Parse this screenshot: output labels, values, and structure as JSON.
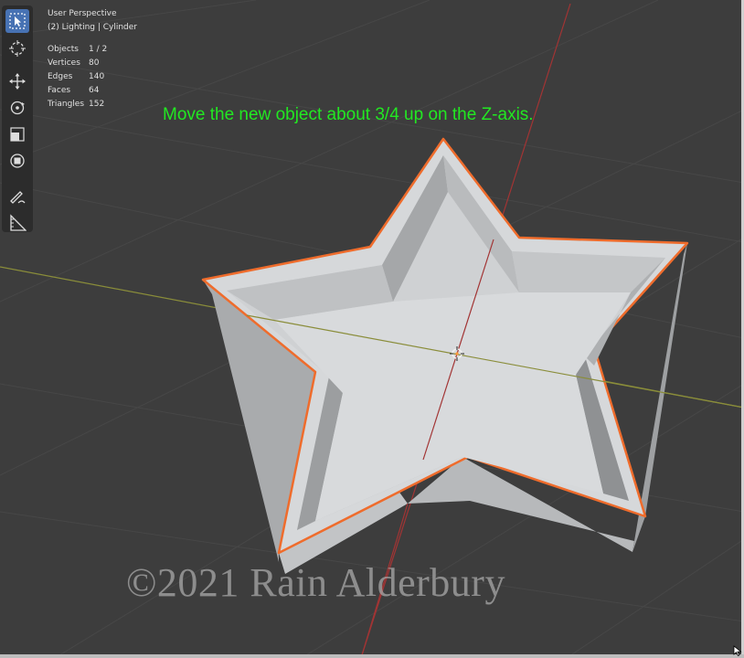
{
  "viewport": {
    "perspective": "User Perspective",
    "collection_info": "(2) Lighting | Cylinder"
  },
  "stats": [
    {
      "label": "Objects",
      "value": "1 / 2"
    },
    {
      "label": "Vertices",
      "value": "80"
    },
    {
      "label": "Edges",
      "value": "140"
    },
    {
      "label": "Faces",
      "value": "64"
    },
    {
      "label": "Triangles",
      "value": "152"
    }
  ],
  "instruction": "Move the new object about 3/4 up on the Z-axis.",
  "watermark": "©2021 Rain Alderbury",
  "toolbar": {
    "tools": [
      "select-box",
      "cursor",
      "move",
      "rotate",
      "scale",
      "transform",
      "annotate",
      "measure"
    ],
    "active_tool": "select-box"
  },
  "colors": {
    "background": "#3d3d3d",
    "selection_outline": "#e8692e",
    "instruction_text": "#22e822",
    "x_axis": "#9a9a3a",
    "y_axis": "#a53a3a",
    "active_tool": "#4772b3"
  }
}
